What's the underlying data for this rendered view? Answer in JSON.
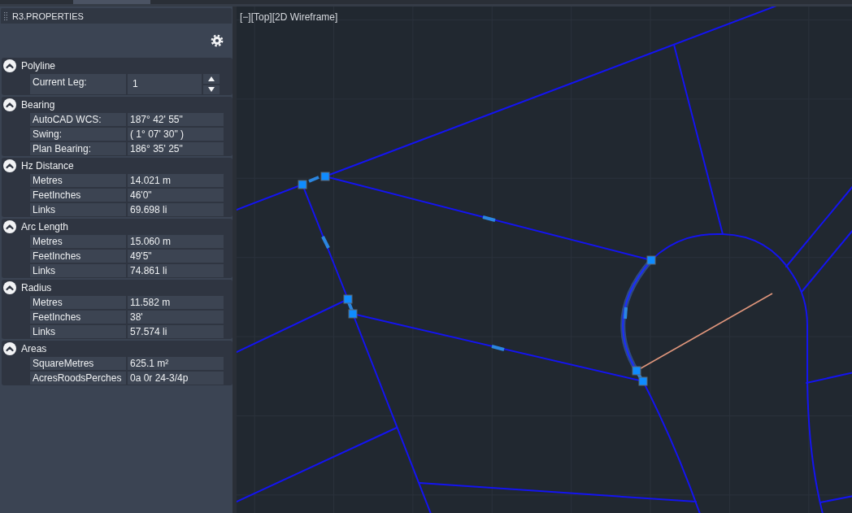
{
  "panel": {
    "title": "R3.PROPERTIES",
    "sections": [
      {
        "title": "Polyline",
        "expanded": true,
        "rows": [
          {
            "kind": "spinner",
            "label": "Current Leg:",
            "value": "1"
          }
        ]
      },
      {
        "title": "Bearing",
        "expanded": true,
        "rows": [
          {
            "kind": "readout",
            "label": "AutoCAD WCS:",
            "value": "187° 42' 55\""
          },
          {
            "kind": "readout",
            "label": "Swing:",
            "value": "( 1° 07' 30\" )"
          },
          {
            "kind": "readout",
            "label": "Plan Bearing:",
            "value": "186° 35' 25\""
          }
        ]
      },
      {
        "title": "Hz Distance",
        "expanded": true,
        "rows": [
          {
            "kind": "readout",
            "label": "Metres",
            "value": "14.021 m"
          },
          {
            "kind": "readout",
            "label": "FeetInches",
            "value": "46'0\""
          },
          {
            "kind": "readout",
            "label": "Links",
            "value": "69.698 li"
          }
        ]
      },
      {
        "title": "Arc Length",
        "expanded": true,
        "rows": [
          {
            "kind": "readout",
            "label": "Metres",
            "value": "15.060 m"
          },
          {
            "kind": "readout",
            "label": "FeetInches",
            "value": "49'5\""
          },
          {
            "kind": "readout",
            "label": "Links",
            "value": "74.861 li"
          }
        ]
      },
      {
        "title": "Radius",
        "expanded": true,
        "rows": [
          {
            "kind": "readout",
            "label": "Metres",
            "value": "11.582 m"
          },
          {
            "kind": "readout",
            "label": "FeetInches",
            "value": "38'"
          },
          {
            "kind": "readout",
            "label": "Links",
            "value": "57.574 li"
          }
        ]
      },
      {
        "title": "Areas",
        "expanded": true,
        "rows": [
          {
            "kind": "readout",
            "label": "SquareMetres",
            "value": "625.1 m²"
          },
          {
            "kind": "readout",
            "label": "AcresRoodsPerches",
            "value": "0a 0r 24-3/4p"
          }
        ]
      }
    ]
  },
  "viewport": {
    "label": "[−][Top][2D Wireframe]"
  }
}
